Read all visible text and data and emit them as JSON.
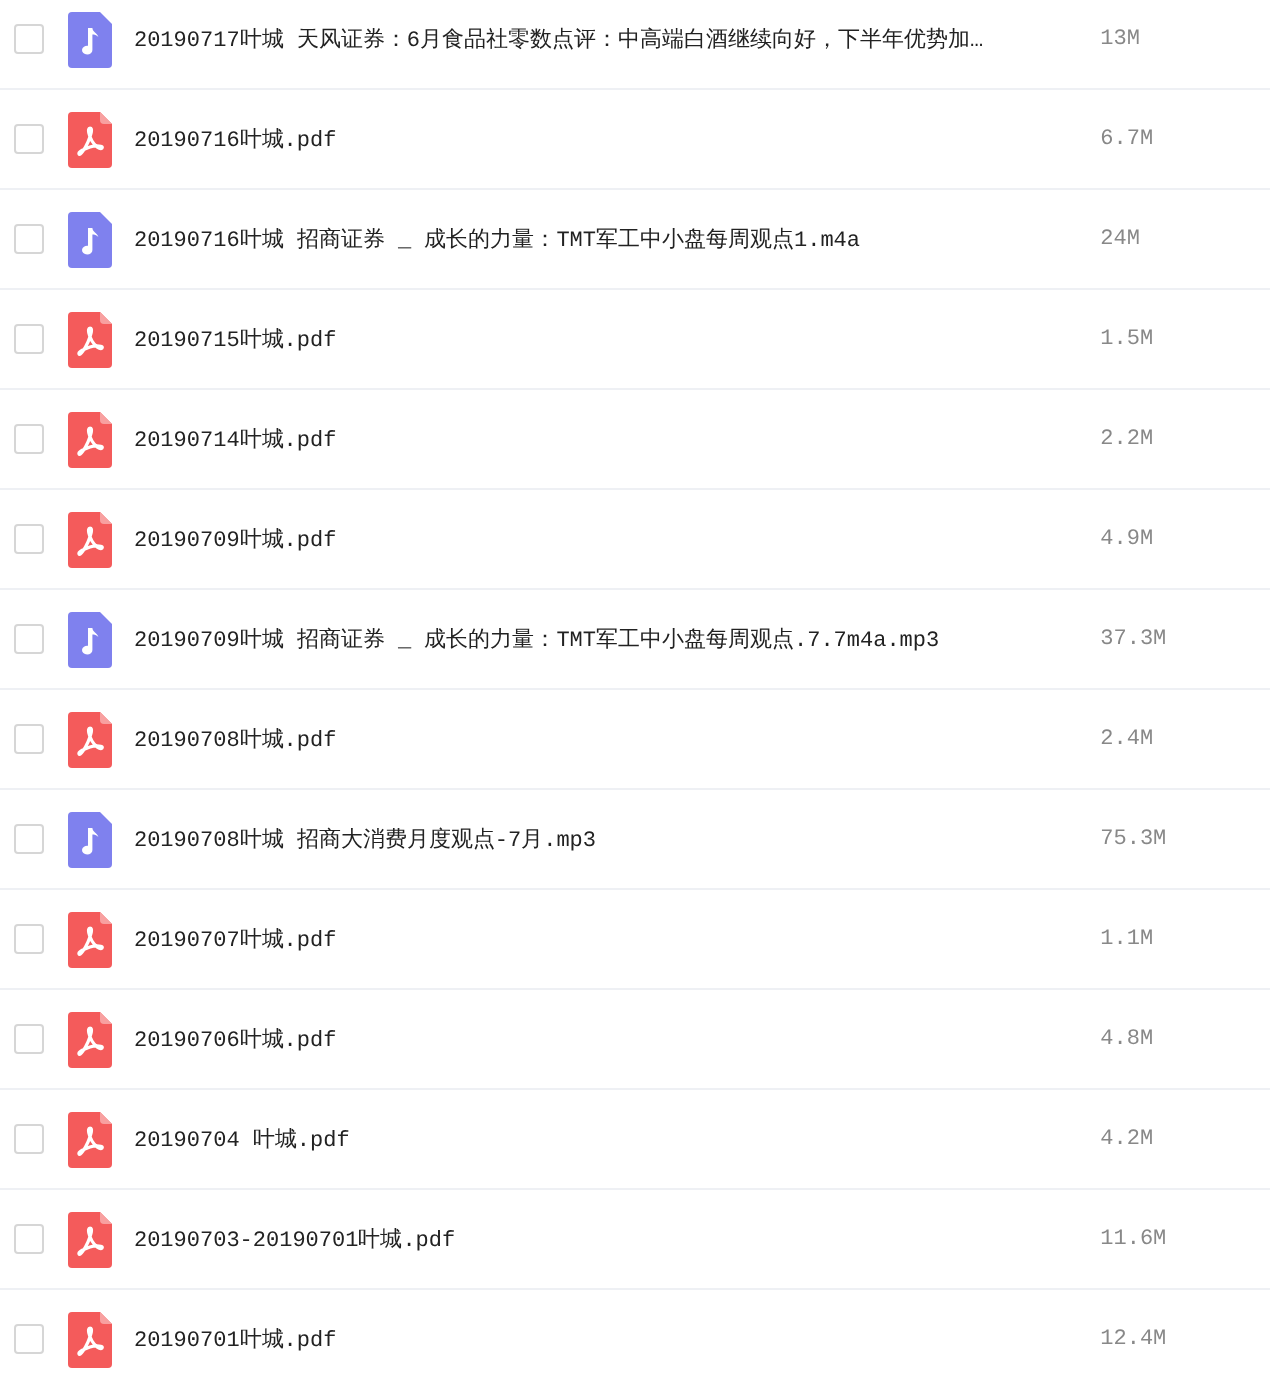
{
  "files": [
    {
      "kind": "audio",
      "name": "20190717叶城 天风证券：6月食品社零数点评：中高端白酒继续向好，下半年优势加…",
      "size": "13M",
      "checked": false
    },
    {
      "kind": "pdf",
      "name": "20190716叶城.pdf",
      "size": "6.7M",
      "checked": false
    },
    {
      "kind": "audio",
      "name": "20190716叶城 招商证券 _ 成长的力量：TMT军工中小盘每周观点1.m4a",
      "size": "24M",
      "checked": false
    },
    {
      "kind": "pdf",
      "name": "20190715叶城.pdf",
      "size": "1.5M",
      "checked": false
    },
    {
      "kind": "pdf",
      "name": "20190714叶城.pdf",
      "size": "2.2M",
      "checked": false
    },
    {
      "kind": "pdf",
      "name": "20190709叶城.pdf",
      "size": "4.9M",
      "checked": false
    },
    {
      "kind": "audio",
      "name": "20190709叶城 招商证券 _ 成长的力量：TMT军工中小盘每周观点.7.7m4a.mp3",
      "size": "37.3M",
      "checked": false
    },
    {
      "kind": "pdf",
      "name": "20190708叶城.pdf",
      "size": "2.4M",
      "checked": false
    },
    {
      "kind": "audio",
      "name": "20190708叶城 招商大消费月度观点-7月.mp3",
      "size": "75.3M",
      "checked": false
    },
    {
      "kind": "pdf",
      "name": "20190707叶城.pdf",
      "size": "1.1M",
      "checked": false
    },
    {
      "kind": "pdf",
      "name": "20190706叶城.pdf",
      "size": "4.8M",
      "checked": false
    },
    {
      "kind": "pdf",
      "name": "20190704 叶城.pdf",
      "size": "4.2M",
      "checked": false
    },
    {
      "kind": "pdf",
      "name": "20190703-20190701叶城.pdf",
      "size": "11.6M",
      "checked": false
    },
    {
      "kind": "pdf",
      "name": "20190701叶城.pdf",
      "size": "12.4M",
      "checked": false
    }
  ]
}
